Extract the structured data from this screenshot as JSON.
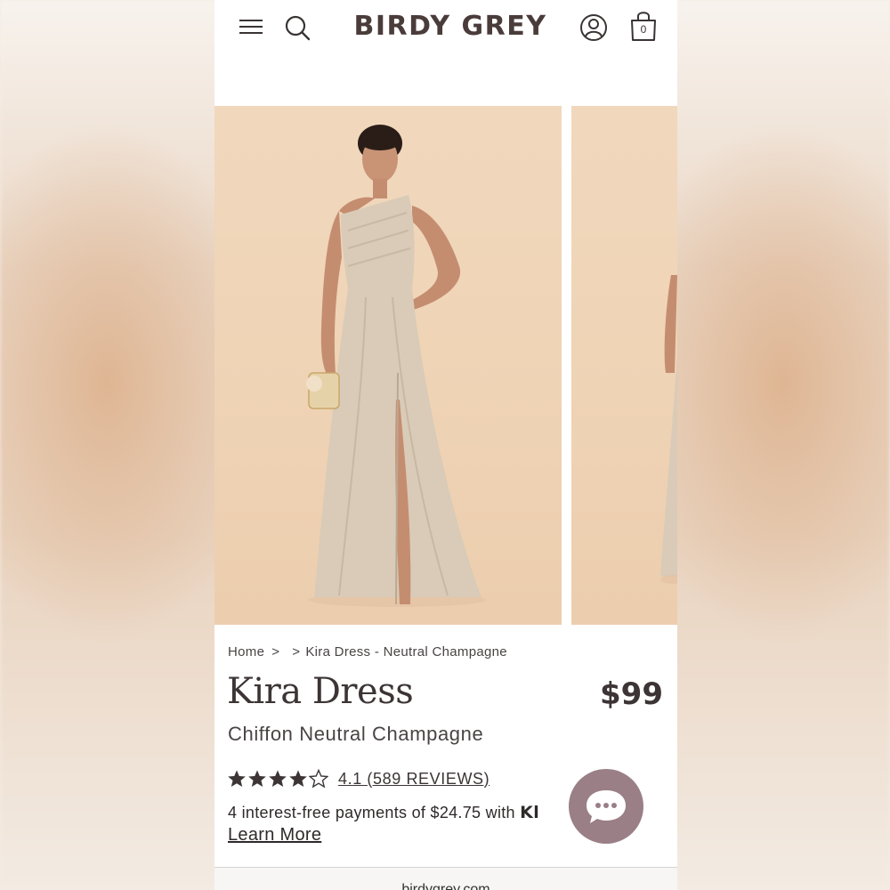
{
  "brand": {
    "logo": "BIRDY GREY"
  },
  "header": {
    "cart_count": "0"
  },
  "breadcrumb": {
    "home": "Home",
    "separator": ">",
    "current": "Kira Dress - Neutral Champagne"
  },
  "product": {
    "title": "Kira Dress",
    "price": "$99",
    "subtitle": "Chiffon Neutral Champagne",
    "rating_value": 4.1,
    "rating_max": 5,
    "reviews_label": "4.1 (589 REVIEWS)",
    "financing_text": "4 interest-free payments of $24.75 with ",
    "financing_provider": "Kl",
    "learn_more": "Learn More"
  },
  "browser": {
    "url": "birdygrey.com"
  },
  "colors": {
    "accent": "#9a7f86",
    "text": "#3d3535",
    "photo_bg": "#efd3b5",
    "dress": "#d9cbb8"
  }
}
